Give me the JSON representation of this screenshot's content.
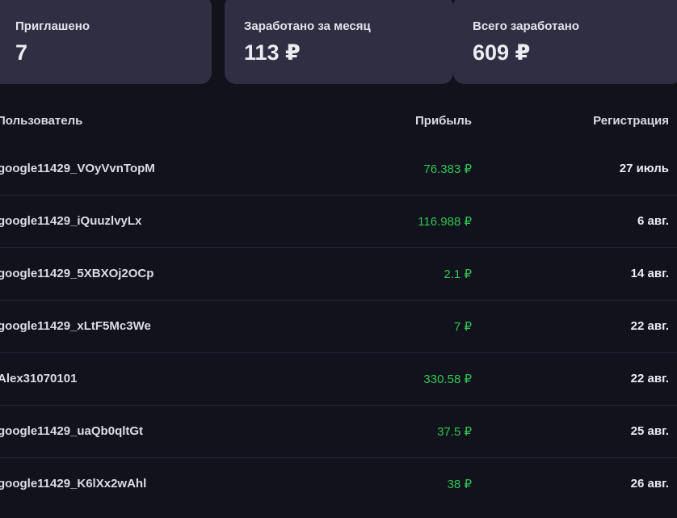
{
  "stats": {
    "invited_label": "Приглашено",
    "invited_value": "7",
    "month_label": "Заработано за месяц",
    "month_value": "113 ₽",
    "total_label": "Всего заработано",
    "total_value": "609 ₽"
  },
  "table": {
    "columns": {
      "user": "Пользователь",
      "profit": "Прибыль",
      "registration": "Регистрация"
    },
    "rows": [
      {
        "user": "google11429_VOyVvnTopM",
        "profit": "76.383 ₽",
        "registration": "27 июль"
      },
      {
        "user": "google11429_iQuuzlvyLx",
        "profit": "116.988 ₽",
        "registration": "6 авг."
      },
      {
        "user": "google11429_5XBXOj2OCp",
        "profit": "2.1 ₽",
        "registration": "14 авг."
      },
      {
        "user": "google11429_xLtF5Mc3We",
        "profit": "7 ₽",
        "registration": "22 авг."
      },
      {
        "user": "Alex31070101",
        "profit": "330.58 ₽",
        "registration": "22 авг."
      },
      {
        "user": "google11429_uaQb0qltGt",
        "profit": "37.5 ₽",
        "registration": "25 авг."
      },
      {
        "user": "google11429_K6lXx2wAhl",
        "profit": "38 ₽",
        "registration": "26 авг."
      }
    ]
  },
  "colors": {
    "background": "#12121c",
    "card": "#302e43",
    "profit": "#2ec653"
  }
}
